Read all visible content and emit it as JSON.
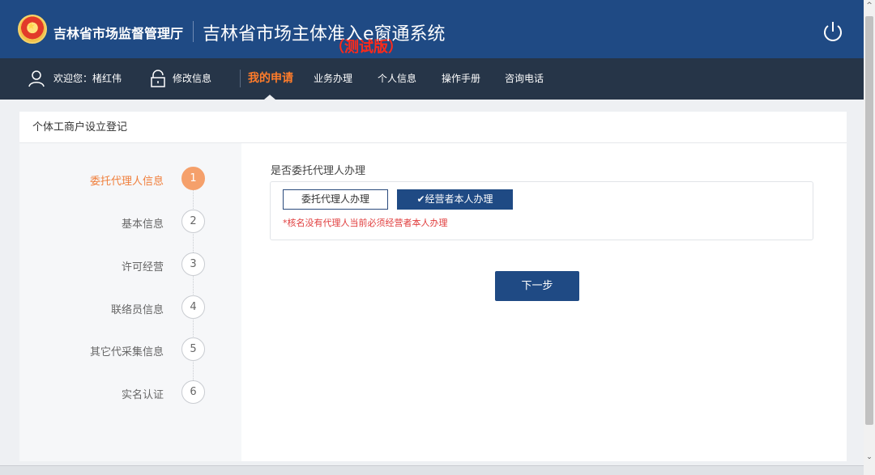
{
  "header": {
    "agency": "吉林省市场监督管理厅",
    "system_title": "吉林省市场主体准入e窗通系统",
    "test_label": "（测试版）"
  },
  "nav": {
    "welcome": "欢迎您：楮红伟",
    "edit_info": "修改信息",
    "items": [
      "我的申请",
      "业务办理",
      "个人信息",
      "操作手册",
      "咨询电话"
    ]
  },
  "panel": {
    "title": "个体工商户设立登记",
    "steps": [
      {
        "num": "1",
        "label": "委托代理人信息",
        "active": true
      },
      {
        "num": "2",
        "label": "基本信息"
      },
      {
        "num": "3",
        "label": "许可经营"
      },
      {
        "num": "4",
        "label": "联络员信息"
      },
      {
        "num": "5",
        "label": "其它代采集信息"
      },
      {
        "num": "6",
        "label": "实名认证"
      }
    ],
    "question": "是否委托代理人办理",
    "option_agent": "委托代理人办理",
    "option_self": "✔经营者本人办理",
    "hint": "*核名没有代理人当前必须经营者本人办理",
    "next": "下一步"
  },
  "scroll": {
    "up": "^",
    "down": "⌄"
  },
  "colors": {
    "header_blue": "#1f4a84",
    "nav_dark": "#263548",
    "accent_orange": "#ff7c2a",
    "step_active": "#f5a06b"
  }
}
